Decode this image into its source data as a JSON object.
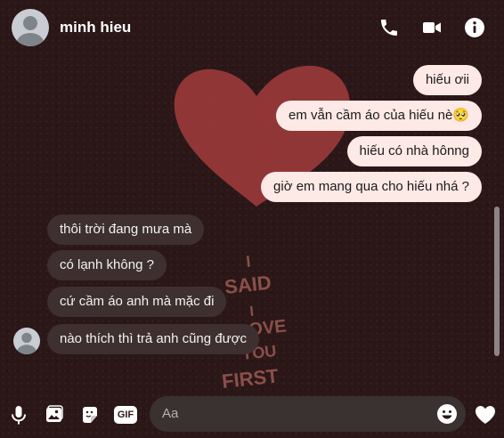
{
  "header": {
    "contact_name": "minh hieu",
    "icons": [
      "phone-icon",
      "video-camera-icon",
      "info-icon"
    ]
  },
  "background_art": {
    "text_lines": [
      "I",
      "SAID",
      "I",
      "LOVE",
      "YOU",
      "FIRST"
    ]
  },
  "messages": [
    {
      "sender": "me",
      "text": "hiếu ơii"
    },
    {
      "sender": "me",
      "text": "em vẫn cầm áo của hiếu nè"
    },
    {
      "sender": "me",
      "text": "hiếu có nhà hônng"
    },
    {
      "sender": "me",
      "text": "giờ em mang qua cho hiếu nhá ?"
    },
    {
      "sender": "them",
      "text": "thôi trời đang mưa mà"
    },
    {
      "sender": "them",
      "text": "có lạnh không ?"
    },
    {
      "sender": "them",
      "text": "cứ cầm áo anh mà mặc đi"
    },
    {
      "sender": "them",
      "text": "nào thích thì trả anh cũng được"
    }
  ],
  "message_emoji": "🥺",
  "composer": {
    "placeholder": "Aa",
    "tools": [
      "microphone-icon",
      "image-icon",
      "sticker-icon",
      "gif-icon"
    ],
    "gif_label": "GIF"
  },
  "colors": {
    "background": "#2b1717",
    "my_bubble": "#fde9e6",
    "their_bubble": "#3e3030",
    "heart_art": "#9a3a3a"
  }
}
